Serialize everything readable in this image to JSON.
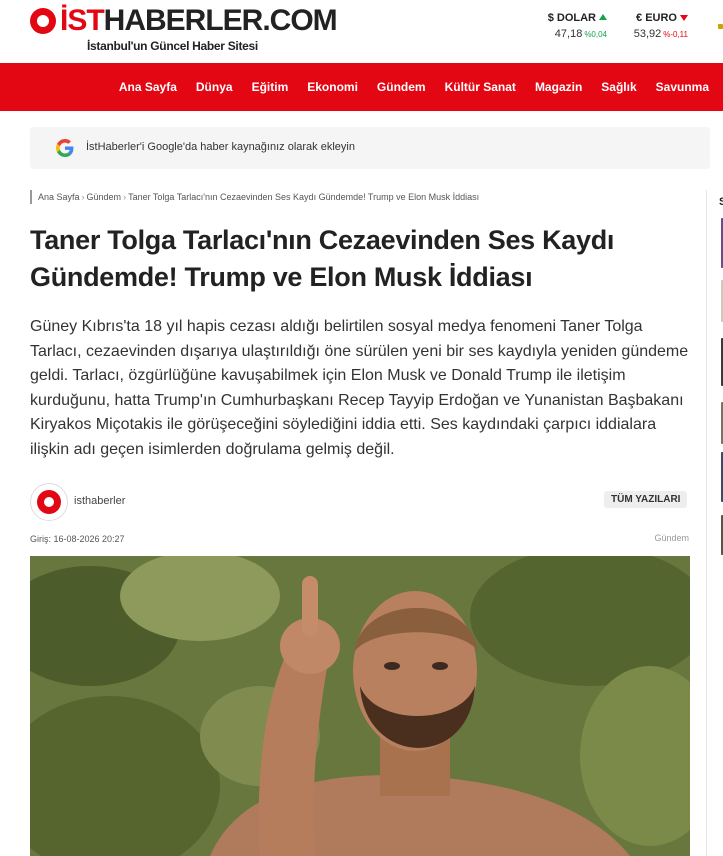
{
  "header": {
    "logo": {
      "ist": "İST",
      "rest": "HABERLER.COM",
      "slogan": "İstanbul'un Güncel Haber Sitesi"
    },
    "currencies": [
      {
        "name": "$ DOLAR",
        "value": "47,18",
        "change": "%0,04",
        "direction": "up"
      },
      {
        "name": "€ EURO",
        "value": "53,92",
        "change": "%-0,11",
        "direction": "down"
      }
    ]
  },
  "nav": {
    "items": [
      "Ana Sayfa",
      "Dünya",
      "Eğitim",
      "Ekonomi",
      "Gündem",
      "Kültür Sanat",
      "Magazin",
      "Sağlık",
      "Savunma"
    ]
  },
  "google_bar": {
    "icon": "google-icon",
    "text": "İstHaberler'i Google'da haber kaynağınız olarak ekleyin"
  },
  "breadcrumb": [
    "Ana Sayfa",
    "Gündem",
    "Taner Tolga Tarlacı'nın Cezaevinden Ses Kaydı Gündemde! Trump ve Elon Musk İddiası"
  ],
  "article": {
    "title": "Taner Tolga Tarlacı'nın Cezaevinden Ses Kaydı Gündemde! Trump ve Elon Musk İddiası",
    "summary": "Güney Kıbrıs'ta 18 yıl hapis cezası aldığı belirtilen sosyal medya fenomeni Taner Tolga Tarlacı, cezaevinden dışarıya ulaştırıldığı öne sürülen yeni bir ses kaydıyla yeniden gündeme geldi. Tarlacı, özgürlüğüne kavuşabilmek için Elon Musk ve Donald Trump ile iletişim kurduğunu, hatta Trump'ın Cumhurbaşkanı Recep Tayyip Erdoğan ve Yunanistan Başbakanı Kiryakos Miçotakis ile görüşeceğini söylediğini iddia etti. Ses kaydındaki çarpıcı iddialara ilişkin adı geçen isimlerden doğrulama gelmiş değil.",
    "author": "isthaberler",
    "all_posts_label": "TÜM YAZILARI",
    "date": "Giriş: 16-08-2026 20:27",
    "category": "Gündem"
  },
  "sidebar": {
    "partial_heading": "S"
  },
  "colors": {
    "brand_red": "#e30613",
    "up_green": "#16a34a"
  }
}
